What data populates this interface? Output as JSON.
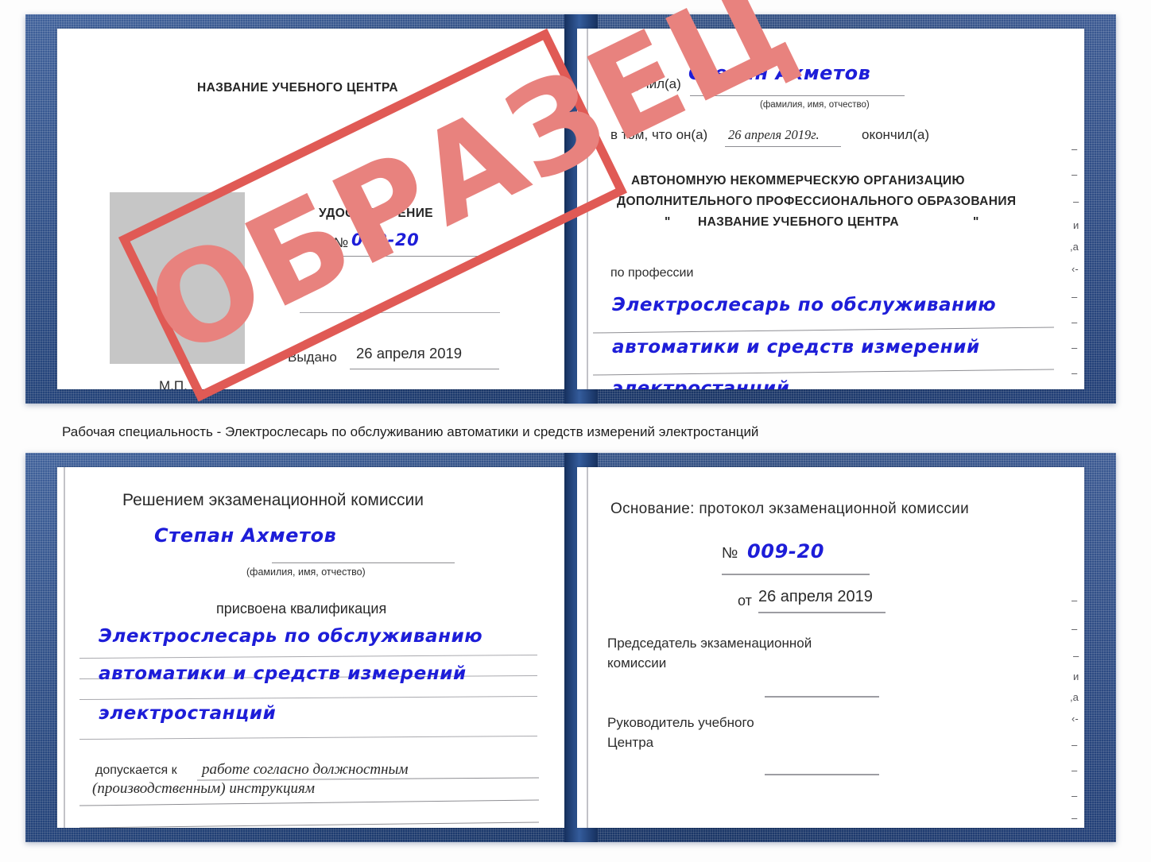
{
  "caption": "Рабочая специальность - Электрослесарь по обслуживанию автоматики и средств измерений электростанций",
  "stamp": {
    "text": "ОБРАЗЕЦ",
    "frame_color": "#e05a55",
    "text_color": "#e8827e"
  },
  "colors": {
    "cover_blue": "#20437f",
    "handwriting_blue": "#1d1dd8",
    "photo_gray": "#c6c6c6",
    "rule_gray": "#8d8d92"
  },
  "certificate_top": {
    "left_page": {
      "org_title": "НАЗВАНИЕ УЧЕБНОГО ЦЕНТРА",
      "doc_title": "УДОСТОВЕРЕНИЕ",
      "number_label": "№",
      "number_value": "009-20",
      "issued_label": "Выдано",
      "issued_value": "26 апреля 2019",
      "seal_label": "М.П.",
      "photo_placeholder": ""
    },
    "right_page": {
      "received_label": "Получил(а)",
      "received_value": "Степан Ахметов",
      "fio_hint": "(фамилия, имя, отчество)",
      "in_that_label": "в том, что он(а)",
      "in_that_date": "26 апреля 2019г.",
      "finished_label": "окончил(а)",
      "org_line1": "АВТОНОМНУЮ НЕКОММЕРЧЕСКУЮ ОРГАНИЗАЦИЮ",
      "org_line2": "ДОПОЛНИТЕЛЬНОГО ПРОФЕССИОНАЛЬНОГО ОБРАЗОВАНИЯ",
      "org_quote_open": "\"",
      "org_line3": "НАЗВАНИЕ УЧЕБНОГО ЦЕНТРА",
      "org_quote_close": "\"",
      "profession_label": "по профессии",
      "profession_line1": "Электрослесарь по обслуживанию",
      "profession_line2": "автоматики и средств измерений",
      "profession_line3": "электростанций",
      "edge_marks": [
        "–",
        "–",
        "–",
        "и",
        ",а",
        "‹-",
        "–",
        "–",
        "–",
        "–"
      ]
    }
  },
  "certificate_bottom": {
    "left_page": {
      "decision_title": "Решением экзаменационной комиссии",
      "name_value": "Степан Ахметов",
      "fio_hint": "(фамилия, имя, отчество)",
      "qualification_label": "присвоена квалификация",
      "qualification_line1": "Электрослесарь по обслуживанию",
      "qualification_line2": "автоматики и средств измерений",
      "qualification_line3": "электростанций",
      "admitted_label": "допускается к",
      "admitted_value1": "работе согласно должностным",
      "admitted_value2": "(производственным) инструкциям"
    },
    "right_page": {
      "basis_label": "Основание: протокол экзаменационной комиссии",
      "number_label": "№",
      "number_value": "009-20",
      "date_label": "от",
      "date_value": "26 апреля 2019",
      "chairman_line1": "Председатель экзаменационной",
      "chairman_line2": "комиссии",
      "head_line1": "Руководитель учебного",
      "head_line2": "Центра",
      "edge_marks": [
        "–",
        "–",
        "–",
        "и",
        ",а",
        "‹-",
        "–",
        "–",
        "–",
        "–"
      ]
    }
  }
}
